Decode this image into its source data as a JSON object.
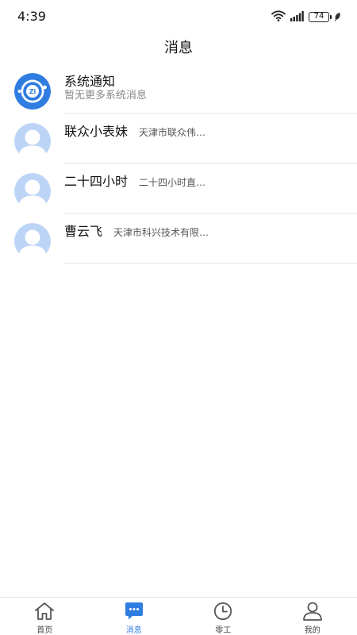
{
  "status_bar": {
    "time": "4:39",
    "battery": "74"
  },
  "header": {
    "title": "消息"
  },
  "messages": {
    "system": {
      "name": "系统通知",
      "subtitle": "暂无更多系统消息"
    },
    "items": [
      {
        "name": "联众小表妹",
        "preview": "天津市联众伟…"
      },
      {
        "name": "二十四小时",
        "preview": "二十四小时直…"
      },
      {
        "name": "曹云飞",
        "preview": "天津市科兴技术有限…"
      }
    ]
  },
  "tab_bar": {
    "tabs": [
      {
        "label": "首页",
        "icon": "home-icon"
      },
      {
        "label": "消息",
        "icon": "chat-icon"
      },
      {
        "label": "零工",
        "icon": "clock-icon"
      },
      {
        "label": "我的",
        "icon": "person-icon"
      }
    ],
    "active_index": 1
  },
  "colors": {
    "accent": "#2f7de1",
    "system_avatar": "#2f7de1",
    "default_avatar": "#bcd4f6"
  }
}
